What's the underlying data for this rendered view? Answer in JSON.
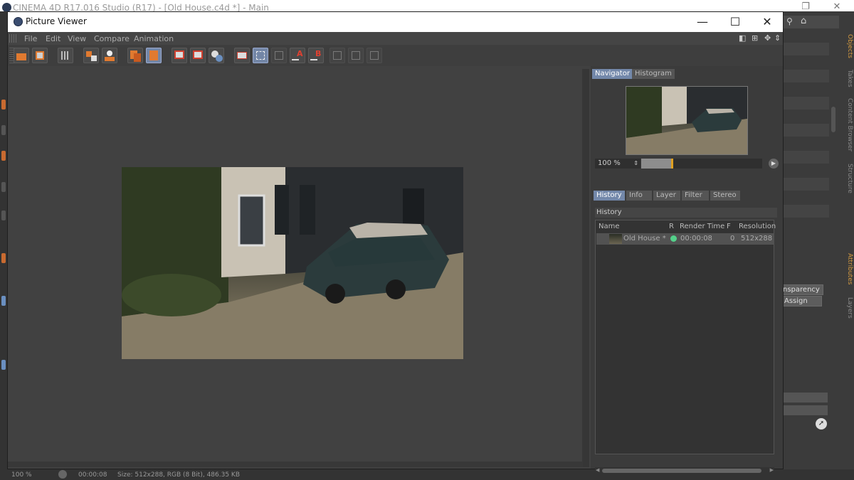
{
  "main_window": {
    "title": "CINEMA 4D R17.016 Studio (R17) - [Old House.c4d *] - Main",
    "side_tabs": [
      "Objects",
      "Takes",
      "Content Browser",
      "Structure"
    ],
    "attribute_tabs": [
      "Attributes",
      "Layers"
    ],
    "attribute_buttons": [
      "nsparency",
      "Assign"
    ],
    "status_left": "100 %",
    "status_time": "00:00:08",
    "status_info": "Size: 512x288, RGB (8 Bit), 486.35 KB"
  },
  "picture_viewer": {
    "title": "Picture Viewer",
    "window_controls": [
      "—",
      "☐",
      "✕"
    ],
    "menu": [
      "File",
      "Edit",
      "View",
      "Compare",
      "Animation"
    ],
    "toolbar_ab_labels": [
      "A",
      "B"
    ],
    "navigator_tabs": [
      "Navigator",
      "Histogram"
    ],
    "zoom": {
      "value": "100 %",
      "fraction": 0.25
    },
    "panel_tabs": [
      "History",
      "Info",
      "Layer",
      "Filter",
      "Stereo"
    ],
    "history": {
      "heading": "History",
      "columns": [
        "Name",
        "R",
        "Render Time",
        "F",
        "Resolution"
      ],
      "rows": [
        {
          "name": "Old House *",
          "render_time": "00:00:08",
          "frame": "0",
          "resolution": "512x288",
          "status_color": "#54d08a"
        }
      ]
    }
  },
  "colors": {
    "accent_tab": "#7388aa",
    "zoom_handle": "#e0a020"
  }
}
